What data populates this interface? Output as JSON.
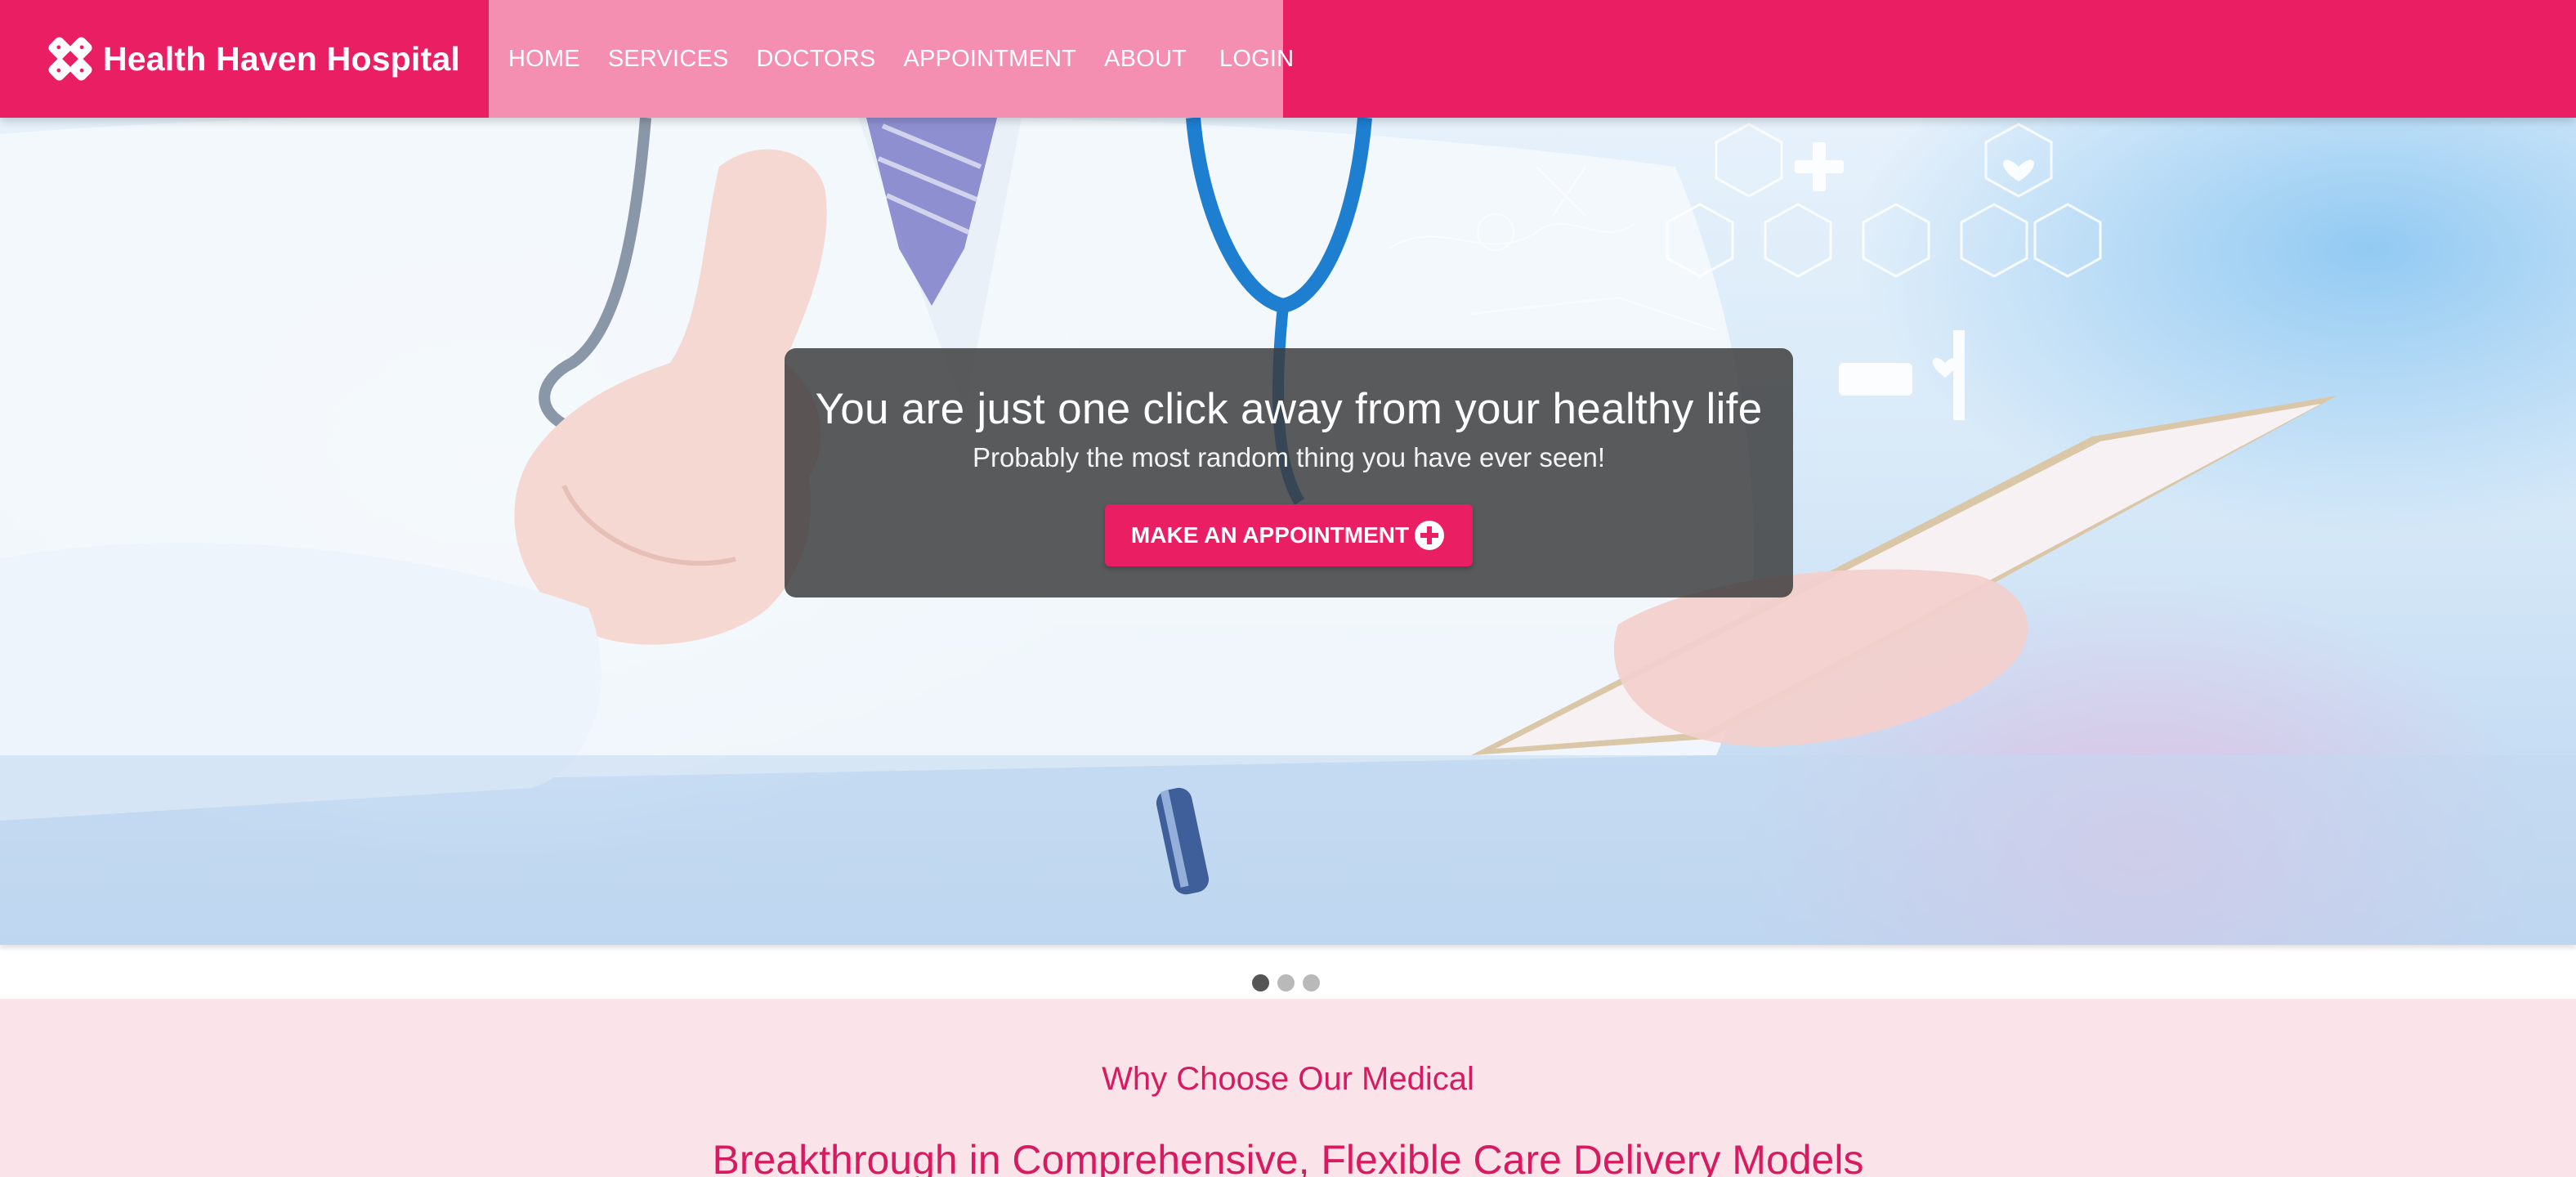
{
  "brand": {
    "name": "Health Haven Hospital",
    "logo_icon": "bandage-cross-icon"
  },
  "colors": {
    "primary": "#e91e63",
    "nav_bg": "#f48fb1",
    "section_bg": "#fbe3ea",
    "overlay": "#3c3c3c"
  },
  "nav": {
    "items": [
      "HOME",
      "SERVICES",
      "DOCTORS",
      "APPOINTMENT",
      "ABOUT",
      "LOGIN"
    ]
  },
  "hero": {
    "headline": "You are just one click away from your healthy life",
    "subheadline": "Probably the most random thing you have ever seen!",
    "cta_label": "MAKE AN APPOINTMENT",
    "cta_icon": "plus-circle-icon"
  },
  "carousel": {
    "slides": 3,
    "active_index": 0
  },
  "why": {
    "eyebrow": "Why Choose Our Medical",
    "title": "Breakthrough in Comprehensive, Flexible Care Delivery Models"
  }
}
